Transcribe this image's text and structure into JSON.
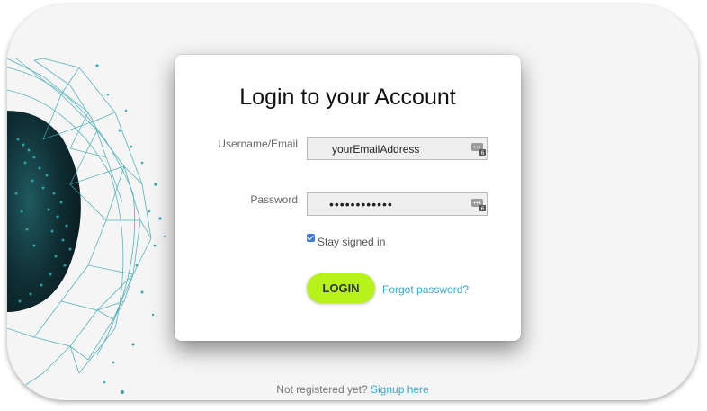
{
  "login": {
    "title": "Login to your Account",
    "username_label": "Username/Email",
    "username_value": "yourEmailAddress",
    "password_label": "Password",
    "password_value": "••••••••••••",
    "stay_signed_in_label": "Stay signed in",
    "stay_signed_in_checked": true,
    "login_button": "LOGIN",
    "forgot_password_link": "Forgot password?"
  },
  "footer": {
    "not_registered_text": "Not registered yet?",
    "signup_link": "Signup here"
  },
  "icons": {
    "username_field_icon": "password-manager-key-icon",
    "password_field_icon": "password-manager-key-icon",
    "decoration": "network-globe-icon"
  },
  "colors": {
    "login_button": "#b6f31b",
    "link": "#3aa8cc",
    "checkbox": "#3d7bd6",
    "globe_lines": "#3aa8b2",
    "globe_dark": "#0f2e33"
  }
}
